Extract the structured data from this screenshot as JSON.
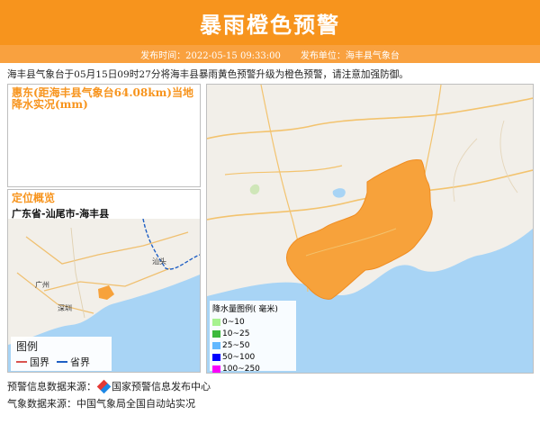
{
  "header": {
    "title": "暴雨橙色预警",
    "publish_time": "发布时间：2022-05-15 09:33:00",
    "publisher": "发布单位：海丰县气象台"
  },
  "description": "海丰县气象台于05月15日09时27分将海丰县暴雨黄色预警升级为橙色预警，请注意加强防御。",
  "rain_panel": {
    "title": "惠东(距海丰县气象台64.08km)当地降水实况(mm)"
  },
  "location_panel": {
    "title": "定位概览",
    "path": "广东省-汕尾市-海丰县"
  },
  "mini_map": {
    "legend_title": "图例",
    "items": [
      {
        "label": "国界",
        "color": "#d9534f"
      },
      {
        "label": "省界",
        "color": "#1f5fc4"
      }
    ],
    "place_labels": [
      "广州",
      "深圳",
      "汕头"
    ]
  },
  "main_map": {
    "legend_title": "降水量图例( 毫米)",
    "legend": [
      {
        "label": "0~10",
        "color": "#a6f28f"
      },
      {
        "label": "10~25",
        "color": "#3cb93c"
      },
      {
        "label": "25~50",
        "color": "#61b8ff"
      },
      {
        "label": "50~100",
        "color": "#0000fe"
      },
      {
        "label": "100~250",
        "color": "#fa00fa"
      }
    ],
    "warning_color": "#f7a23b"
  },
  "footer": {
    "warning_source": "预警信息数据来源：",
    "warning_source_name": "国家预警信息发布中心",
    "weather_source": "气象数据来源：中国气象局全国自动站实况"
  },
  "colors": {
    "header_bg": "#f7941d",
    "sea": "#a8d4f5",
    "land": "#f2efe9"
  }
}
